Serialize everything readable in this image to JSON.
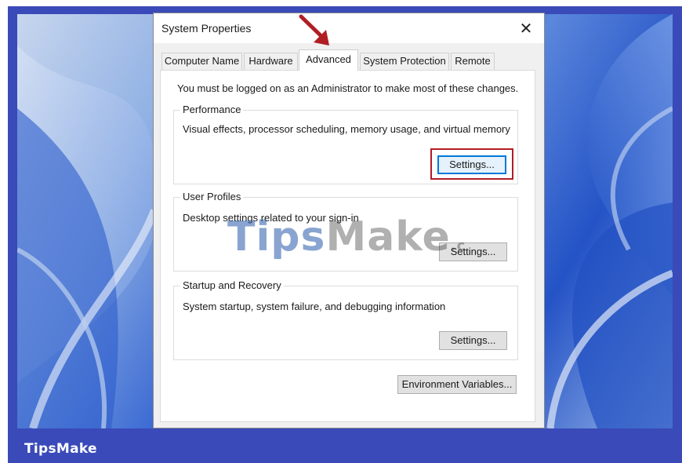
{
  "window": {
    "title": "System Properties",
    "close_glyph": "✕"
  },
  "tabs": [
    {
      "label": "Computer Name",
      "active": false
    },
    {
      "label": "Hardware",
      "active": false
    },
    {
      "label": "Advanced",
      "active": true
    },
    {
      "label": "System Protection",
      "active": false
    },
    {
      "label": "Remote",
      "active": false
    }
  ],
  "advanced": {
    "admin_note": "You must be logged on as an Administrator to make most of these changes.",
    "performance": {
      "title": "Performance",
      "description": "Visual effects, processor scheduling, memory usage, and virtual memory",
      "settings_label": "Settings..."
    },
    "user_profiles": {
      "title": "User Profiles",
      "description": "Desktop settings related to your sign-in",
      "settings_label": "Settings..."
    },
    "startup_recovery": {
      "title": "Startup and Recovery",
      "description": "System startup, system failure, and debugging information",
      "settings_label": "Settings..."
    },
    "env_vars_label": "Environment Variables..."
  },
  "watermark": {
    "brand_a": "Tips",
    "brand_b": "Make",
    "suffix": ".c"
  },
  "footer": {
    "brand": "TipsMake"
  },
  "colors": {
    "highlight": "#b01e24",
    "arrow": "#b01e24",
    "frame_blue": "#3a4ab8"
  }
}
